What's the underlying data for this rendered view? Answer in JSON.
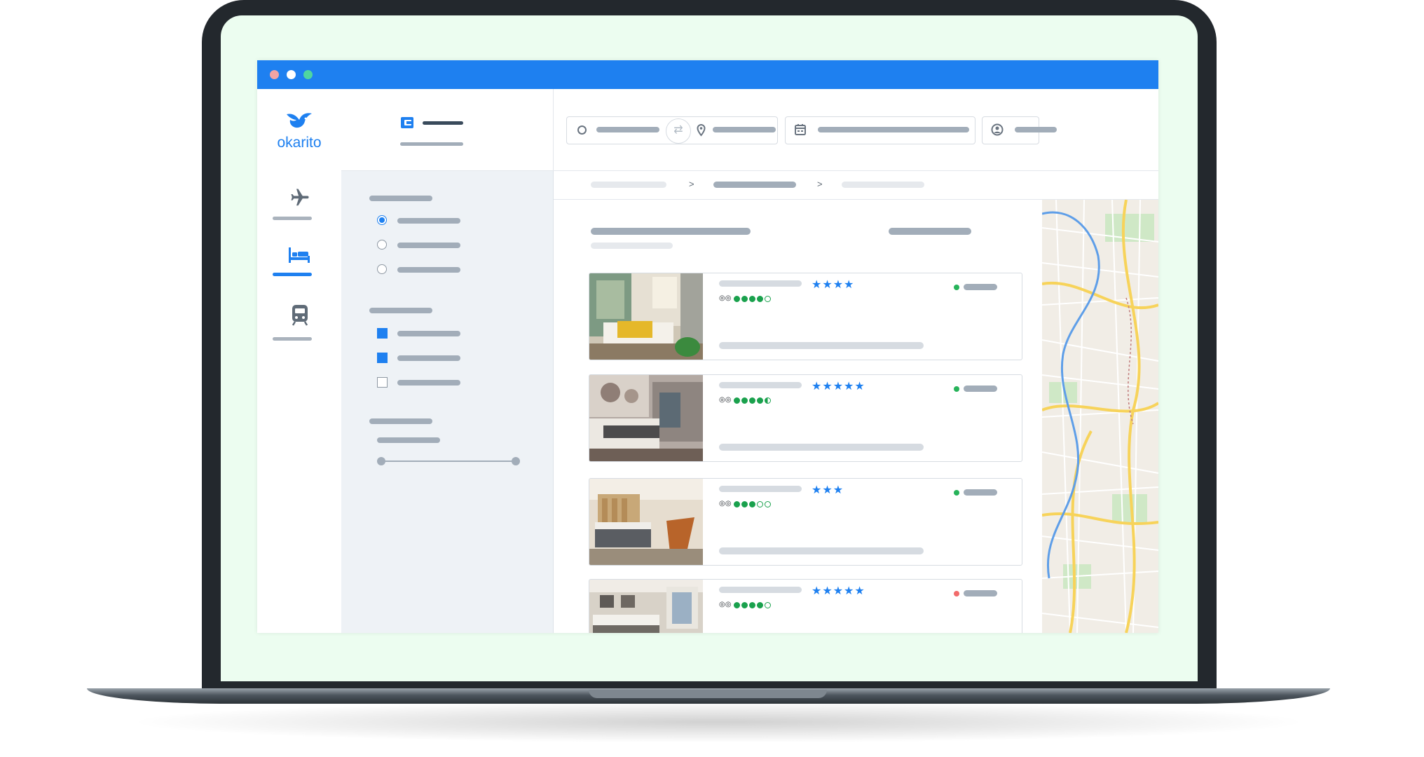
{
  "app": {
    "brand": "okarito",
    "accent": "#1e80f0",
    "window_dots": [
      "#f3a4a4",
      "#ffffff",
      "#4fd6a0"
    ]
  },
  "nav": [
    {
      "id": "flights",
      "icon": "airplane-icon",
      "active": false
    },
    {
      "id": "hotels",
      "icon": "bed-icon",
      "active": true
    },
    {
      "id": "trains",
      "icon": "train-icon",
      "active": false
    }
  ],
  "filters": {
    "sections": [
      {
        "kind": "radio",
        "selected_index": 0,
        "option_count": 3
      },
      {
        "kind": "checkbox",
        "checked": [
          true,
          true,
          false
        ]
      },
      {
        "kind": "range",
        "min_fraction": 0,
        "max_fraction": 1
      }
    ]
  },
  "search_bar": {
    "icons": [
      "origin-circle-icon",
      "swap-arrows-icon",
      "location-pin-icon",
      "calendar-icon",
      "user-icon"
    ]
  },
  "breadcrumb": {
    "separators": [
      ">",
      ">"
    ]
  },
  "hotels": [
    {
      "stars": "★★★★",
      "rating": [
        "f",
        "f",
        "f",
        "f",
        "e"
      ],
      "available": true,
      "status_color": "#27b35a",
      "photo": "hotel-room-green-photo"
    },
    {
      "stars": "★★★★★",
      "rating": [
        "f",
        "f",
        "f",
        "f",
        "h"
      ],
      "available": true,
      "status_color": "#27b35a",
      "photo": "hotel-room-grey-photo"
    },
    {
      "stars": "★★★",
      "rating": [
        "f",
        "f",
        "f",
        "e",
        "e"
      ],
      "available": true,
      "status_color": "#27b35a",
      "photo": "hotel-room-wood-photo"
    },
    {
      "stars": "★★★★★",
      "rating": [
        "f",
        "f",
        "f",
        "f",
        "e"
      ],
      "available": false,
      "status_color": "#f26b6b",
      "photo": "hotel-room-window-photo"
    }
  ]
}
